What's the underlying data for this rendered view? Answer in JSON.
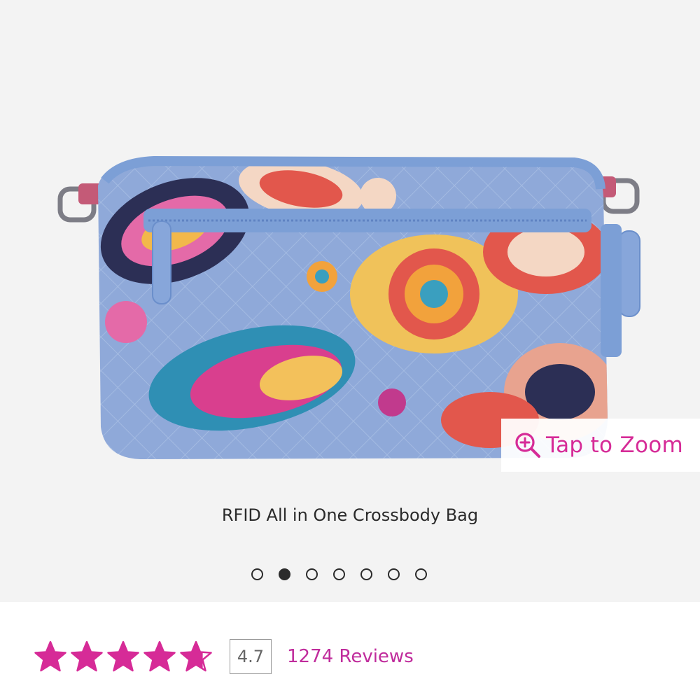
{
  "gallery": {
    "zoom_label": "Tap to Zoom",
    "zoom_icon": "zoom-in-icon",
    "caption": "RFID All in One Crossbody Bag",
    "pager": {
      "total": 7,
      "active_index": 1
    }
  },
  "rating": {
    "stars_value": 4.7,
    "stars_max": 5,
    "score": "4.7",
    "reviews_link": "1274 Reviews"
  },
  "colors": {
    "accent": "#d62b97",
    "link": "#c02c9c",
    "bag_base": "#8fa9d9",
    "background": "#f3f3f3"
  }
}
